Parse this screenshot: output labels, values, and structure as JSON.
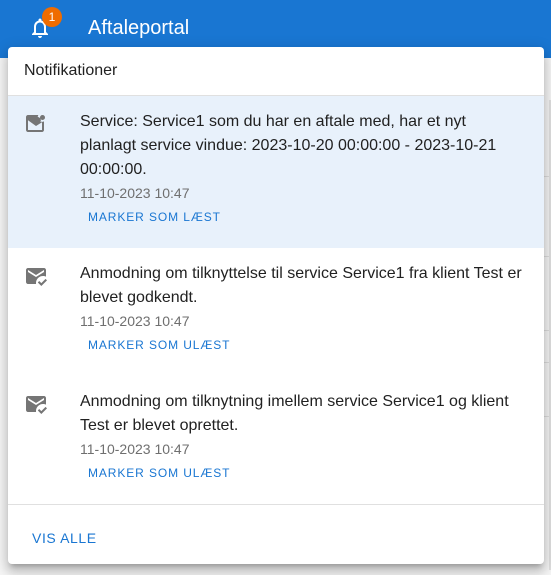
{
  "app": {
    "title": "Aftaleportal",
    "notification_count": "1"
  },
  "popover": {
    "title": "Notifikationer",
    "notifications": [
      {
        "message": "Service: Service1 som du har en aftale med, har et nyt planlagt service vindue: 2023-10-20 00:00:00 - 2023-10-21 00:00:00.",
        "timestamp": "11-10-2023 10:47",
        "action": "MARKER SOM LÆST",
        "status": "unread",
        "icon": "mark-email-unread-icon"
      },
      {
        "message": "Anmodning om tilknyttelse til service Service1 fra klient Test er blevet godkendt.",
        "timestamp": "11-10-2023 10:47",
        "action": "MARKER SOM ULÆST",
        "status": "read",
        "icon": "mark-email-read-icon"
      },
      {
        "message": "Anmodning om tilknytning imellem service Service1 og klient Test er blevet oprettet.",
        "timestamp": "11-10-2023 10:47",
        "action": "MARKER SOM ULÆST",
        "status": "read",
        "icon": "mark-email-read-icon"
      }
    ],
    "view_all": "VIS ALLE"
  },
  "colors": {
    "primary": "#1976d2",
    "badge": "#ef6c00",
    "unread_bg": "#e8f1fb"
  }
}
